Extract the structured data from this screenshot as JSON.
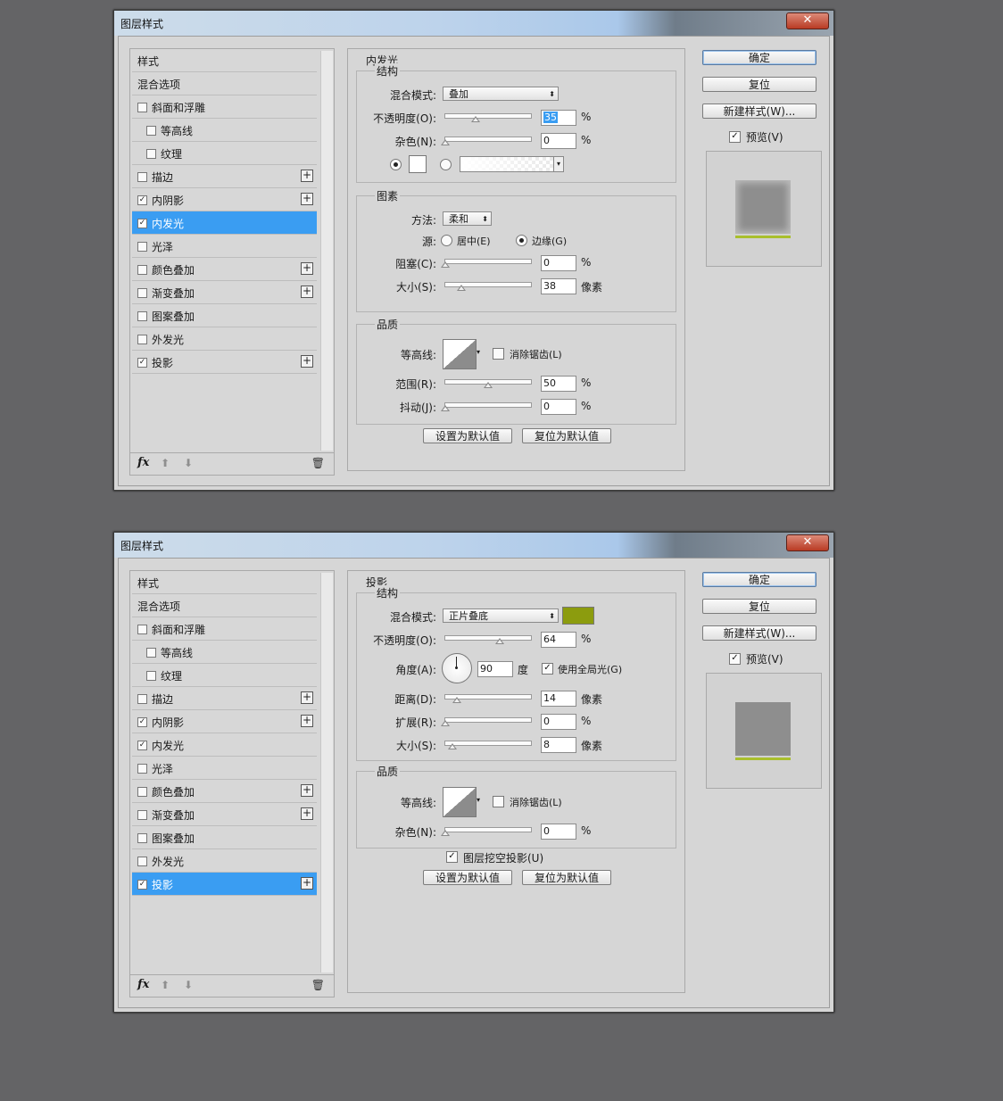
{
  "common": {
    "window_title": "图层样式",
    "close_glyph": "✕",
    "list_header": "样式",
    "list_blend": "混合选项",
    "effects": {
      "bevel": "斜面和浮雕",
      "contour": "等高线",
      "texture": "纹理",
      "stroke": "描边",
      "inner_shadow": "内阴影",
      "inner_glow": "内发光",
      "satin": "光泽",
      "color_overlay": "颜色叠加",
      "gradient_overlay": "渐变叠加",
      "pattern_overlay": "图案叠加",
      "outer_glow": "外发光",
      "drop_shadow": "投影"
    },
    "fx_label": "fx",
    "btn_ok": "确定",
    "btn_reset": "复位",
    "btn_new_style": "新建样式(W)...",
    "preview_label": "预览(V)",
    "btn_set_default": "设置为默认值",
    "btn_reset_default": "复位为默认值",
    "structure": "结构",
    "quality": "品质",
    "elements": "图素",
    "lbl_blend_mode": "混合模式:",
    "lbl_opacity": "不透明度(O):",
    "lbl_noise": "杂色(N):",
    "lbl_technique": "方法:",
    "lbl_source": "源:",
    "lbl_center": "居中(E)",
    "lbl_edge": "边缘(G)",
    "lbl_choke": "阻塞(C):",
    "lbl_size": "大小(S):",
    "lbl_contour": "等高线:",
    "lbl_antialias": "消除锯齿(L)",
    "lbl_range": "范围(R):",
    "lbl_jitter": "抖动(J):",
    "lbl_angle": "角度(A):",
    "lbl_degree": "度",
    "lbl_global_light": "使用全局光(G)",
    "lbl_distance": "距离(D):",
    "lbl_spread": "扩展(R):",
    "lbl_knockout": "图层挖空投影(U)",
    "unit_percent": "%",
    "unit_px": "像素"
  },
  "dialog1": {
    "panel_title": "内发光",
    "blend_mode": "叠加",
    "opacity": "35",
    "opacity_level": 0.35,
    "noise": "0",
    "noise_level": 0,
    "technique": "柔和",
    "choke": "0",
    "choke_level": 0,
    "size": "38",
    "size_level": 0.19,
    "range": "50",
    "range_level": 0.5,
    "jitter": "0",
    "jitter_level": 0
  },
  "dialog2": {
    "panel_title": "投影",
    "blend_mode": "正片叠底",
    "shadow_color": "#8c9c0e",
    "opacity": "64",
    "opacity_level": 0.64,
    "angle": "90",
    "distance": "14",
    "distance_level": 0.14,
    "spread": "0",
    "spread_level": 0,
    "size": "8",
    "size_level": 0.08,
    "noise": "0",
    "noise_level": 0
  },
  "colors": {
    "selection": "#3a9df2",
    "preview_square": "#8e8e8e",
    "preview_accent": "#a9bf2d"
  }
}
